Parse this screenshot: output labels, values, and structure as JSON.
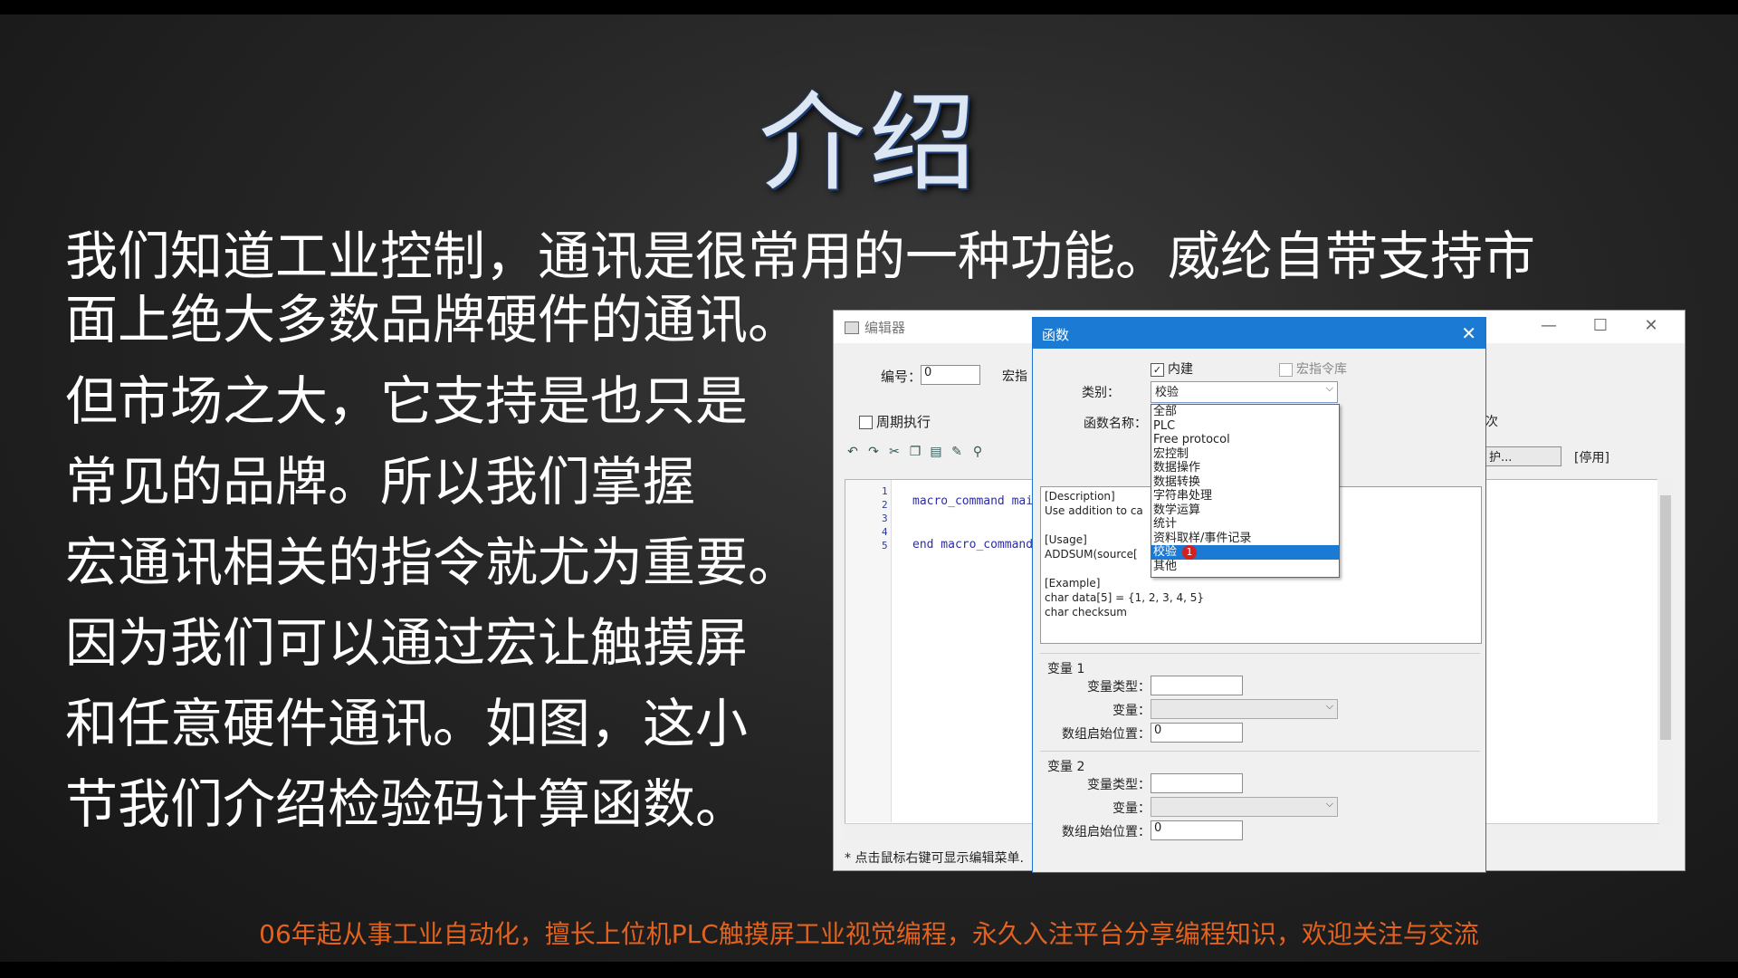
{
  "slide": {
    "title": "介绍",
    "paragraph_lines": [
      "我们知道工业控制，通讯是很常用的一种功能。威纶自带支持市",
      "面上绝大多数品牌硬件的通讯。",
      "但市场之大，它支持是也只是",
      "常见的品牌。所以我们掌握",
      "宏通讯相关的指令就尤为重要。",
      "因为我们可以通过宏让触摸屏",
      "和任意硬件通讯。如图，这小",
      "节我们介绍检验码计算函数。"
    ],
    "footer": "06年起从事工业自动化，擅长上位机PLC触摸屏工业视觉编程，永久入注平台分享编程知识，欢迎关注与交流"
  },
  "editor": {
    "title": "编辑器",
    "number_label": "编号：",
    "number_value": "0",
    "macro_label": "宏指",
    "periodic_label": "周期执行",
    "line_numbers": [
      "1",
      "2",
      "3",
      "4",
      "5"
    ],
    "code_line1": "macro_command mai",
    "code_line5": "end macro_command",
    "hint": "* 点击鼠标右键可显示编辑菜单.",
    "right_label_1": "次",
    "right_label_2": "护...",
    "right_label_3": "[停用]",
    "window_buttons": [
      "—",
      "☐",
      "✕"
    ]
  },
  "dialog": {
    "title": "函数",
    "close": "✕",
    "builtin_label": "内建",
    "macro_lib_label": "宏指令库",
    "category_label": "类别：",
    "category_value": "校验",
    "function_name_label": "函数名称：",
    "dropdown_items": [
      "全部",
      "PLC",
      "Free protocol",
      "宏控制",
      "数据操作",
      "数据转换",
      "字符串处理",
      "数学运算",
      "统计",
      "资料取样/事件记录",
      "校验",
      "其他"
    ],
    "dropdown_selected": "校验",
    "badge": "1",
    "description_lines": [
      "[Description]",
      "   Use addition to ca",
      "",
      "[Usage]",
      "   ADDSUM(source[",
      "",
      "[Example]",
      "   char data[5] = {1, 2, 3, 4, 5}",
      "   char checksum"
    ],
    "var1": {
      "group_label": "变量 1",
      "type_label": "变量类型：",
      "var_label": "变量：",
      "start_label": "数组启始位置：",
      "start_value": "0"
    },
    "var2": {
      "group_label": "变量 2",
      "type_label": "变量类型：",
      "var_label": "变量：",
      "start_label": "数组启始位置：",
      "start_value": "0"
    }
  },
  "colors": {
    "footer": "#e2621f",
    "dialog_title": "#1a7ad4",
    "selection": "#1a7ad4"
  }
}
